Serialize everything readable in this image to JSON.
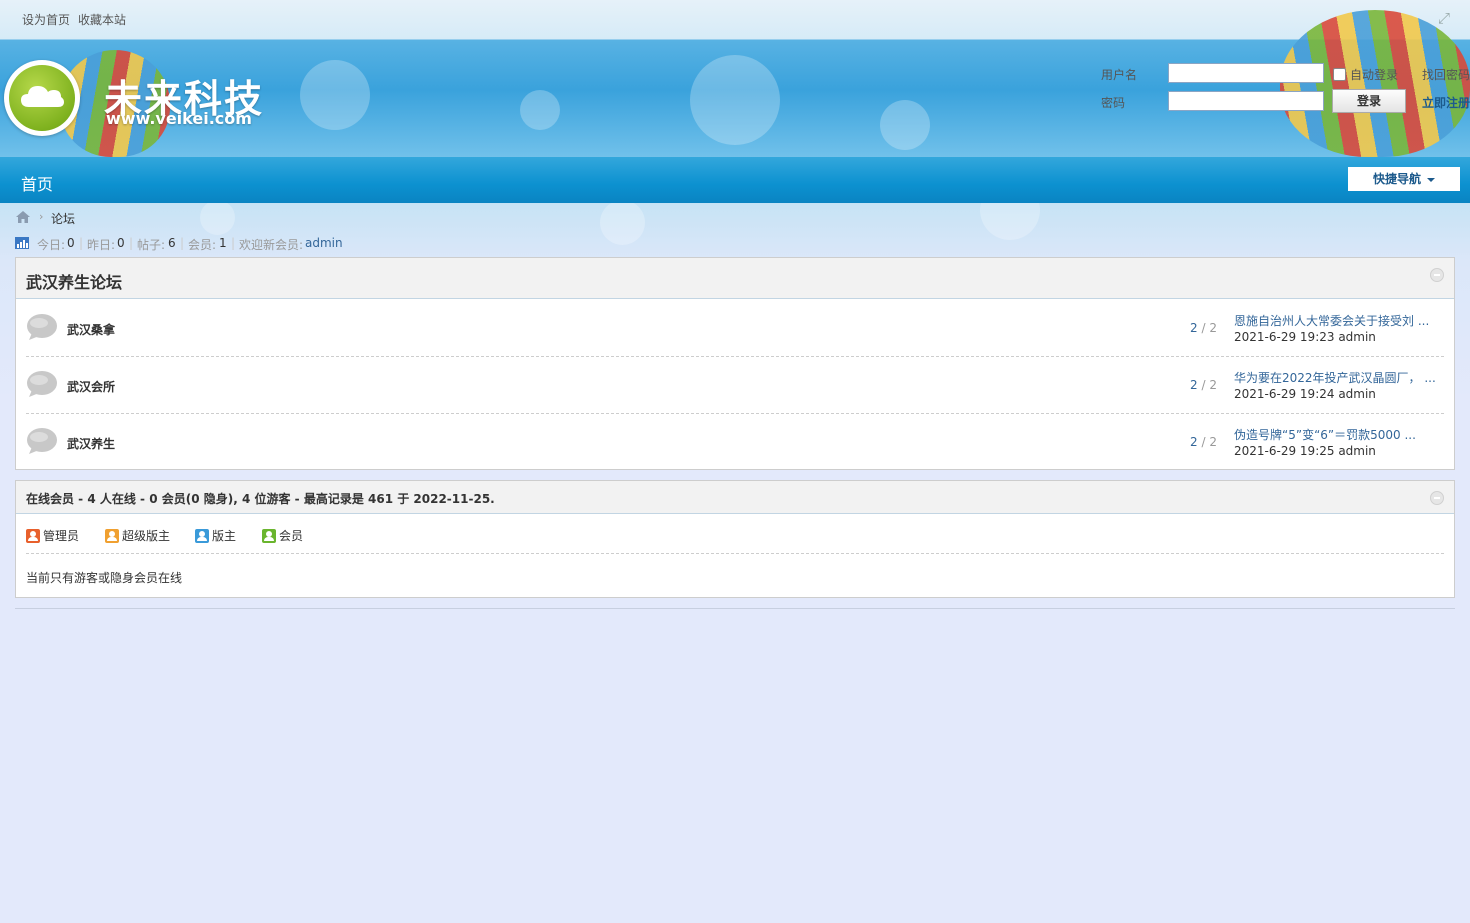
{
  "topbar": {
    "set_homepage": "设为首页",
    "bookmark": "收藏本站",
    "fullscreen_icon": "expand-icon"
  },
  "logo": {
    "title": "未来科技",
    "url": "www.veikei.com"
  },
  "login": {
    "username_label": "用户名",
    "password_label": "密码",
    "username_value": "",
    "password_value": "",
    "auto_login_label": "自动登录",
    "auto_login_checked": false,
    "find_password": "找回密码",
    "login_button": "登录",
    "register": "立即注册"
  },
  "nav": {
    "home": "首页",
    "quick_nav": "快捷导航"
  },
  "breadcrumb": {
    "home_icon": "home-icon",
    "separator": "›",
    "current": "论坛"
  },
  "stats": {
    "today_label": "今日:",
    "today_value": "0",
    "yesterday_label": "昨日:",
    "yesterday_value": "0",
    "posts_label": "帖子:",
    "posts_value": "6",
    "members_label": "会员:",
    "members_value": "1",
    "welcome_label": "欢迎新会员:",
    "newest_member": "admin",
    "separator": "|"
  },
  "forum_group": {
    "title": "武汉养生论坛",
    "forums": [
      {
        "name": "武汉桑拿",
        "threads": "2",
        "posts": "2",
        "last_title": "恩施自治州人大常委会关于接受刘 ...",
        "last_meta": "2021-6-29 19:23 admin"
      },
      {
        "name": "武汉会所",
        "threads": "2",
        "posts": "2",
        "last_title": "华为要在2022年投产武汉晶圆厂， ...",
        "last_meta": "2021-6-29 19:24 admin"
      },
      {
        "name": "武汉养生",
        "threads": "2",
        "posts": "2",
        "last_title": "伪造号牌“5”变“6”＝罚款5000 ...",
        "last_meta": "2021-6-29 19:25 admin"
      }
    ]
  },
  "online": {
    "title": "在线会员 - 4 人在线 - 0 会员(0 隐身), 4 位游客 - 最高记录是 461 于 2022-11-25.",
    "legend": [
      {
        "label": "管理员",
        "color": "#e8602c"
      },
      {
        "label": "超级版主",
        "color": "#f0a030"
      },
      {
        "label": "版主",
        "color": "#3a9ad9"
      },
      {
        "label": "会员",
        "color": "#6ab52e"
      }
    ],
    "message": "当前只有游客或隐身会员在线"
  },
  "colors": {
    "nav_blue": "#0c91d0",
    "link_blue": "#336699",
    "page_bg": "#e3e9fb"
  }
}
